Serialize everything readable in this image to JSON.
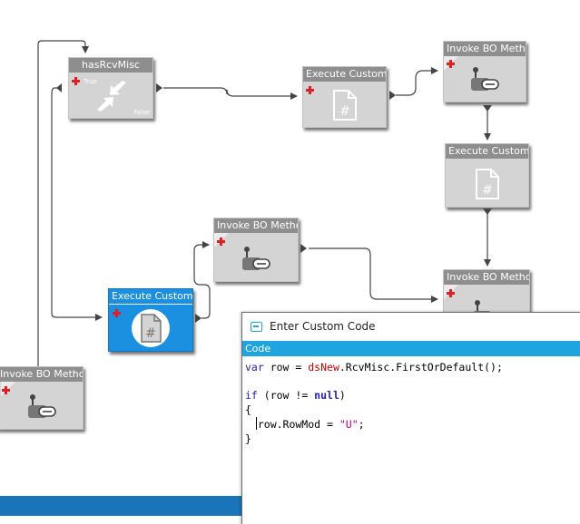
{
  "workflow": {
    "nodes": {
      "has_rcv_misc": {
        "title": "hasRcvMisc",
        "true_label": "True",
        "false_label": "False",
        "icon": "condition-arrows-icon"
      },
      "exec_code_1": {
        "title": "Execute Custom Co",
        "icon": "code-file-icon"
      },
      "invoke_bo_1": {
        "title": "Invoke BO Method",
        "icon": "bo-method-icon"
      },
      "exec_code_2": {
        "title": "Execute Custom Co",
        "icon": "code-file-icon"
      },
      "invoke_bo_2": {
        "title": "Invoke BO Method",
        "icon": "bo-method-icon"
      },
      "exec_code_selected": {
        "title": "Execute Custom Co",
        "icon": "code-file-icon"
      },
      "invoke_bo_3": {
        "title": "Invoke BO Method",
        "icon": "bo-method-icon"
      },
      "invoke_bo_left": {
        "title": "Invoke BO Method",
        "icon": "bo-method-icon"
      }
    },
    "colors": {
      "node_bg": "#d4d4d4",
      "node_header": "#8e8e8e",
      "selected": "#1b8fe0",
      "plus": "#e02020",
      "bottom_bar": "#1a74b8"
    }
  },
  "dialog": {
    "title": "Enter Custom Code",
    "tab": "Code",
    "code": {
      "l1": {
        "kw": "var",
        "a": " row = ",
        "v": "dsNew",
        "b": ".RcvMisc.FirstOrDefault();"
      },
      "l3": {
        "kw": "if",
        "a": " (row != ",
        "kw2": "null",
        "b": ")"
      },
      "l4": "{",
      "l5": {
        "a": "  row.RowMod = ",
        "s": "\"U\"",
        "b": ";"
      },
      "l6": "}"
    },
    "colors": {
      "tab": "#1ea4df",
      "keyword": "#1e1eb4",
      "variable": "#c00000",
      "string": "#b5007b"
    }
  }
}
